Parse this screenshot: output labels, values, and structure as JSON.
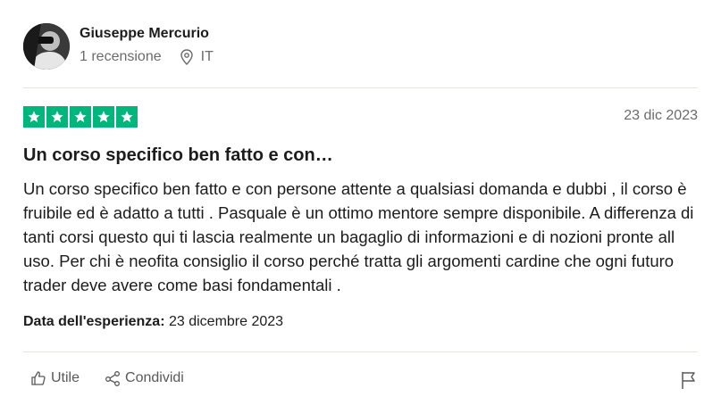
{
  "author": {
    "name": "Giuseppe Mercurio",
    "reviews_count": "1 recensione",
    "country": "IT"
  },
  "review": {
    "rating": 5,
    "rating_max": 5,
    "date": "23 dic 2023",
    "title": "Un corso specifico ben fatto e con…",
    "body": "Un corso specifico ben fatto e con persone attente a qualsiasi domanda e dubbi , il corso è fruibile ed è adatto a tutti . Pasquale è un ottimo mentore sempre disponibile. A differenza di tanti corsi questo qui ti lascia realmente un bagaglio di informazioni e di nozioni pronte all uso. Per chi è neofita consiglio il corso perché tratta gli argomenti cardine che ogni futuro trader deve avere come basi fondamentali .",
    "experience_label": "Data dell'esperienza:",
    "experience_date": "23 dicembre 2023"
  },
  "actions": {
    "useful_label": "Utile",
    "share_label": "Condividi"
  },
  "colors": {
    "star_green": "#00b67a",
    "muted_text": "#6b6b6b"
  },
  "icons": [
    "location-pin-icon",
    "star-icon",
    "thumbs-up-icon",
    "share-icon",
    "flag-icon"
  ]
}
